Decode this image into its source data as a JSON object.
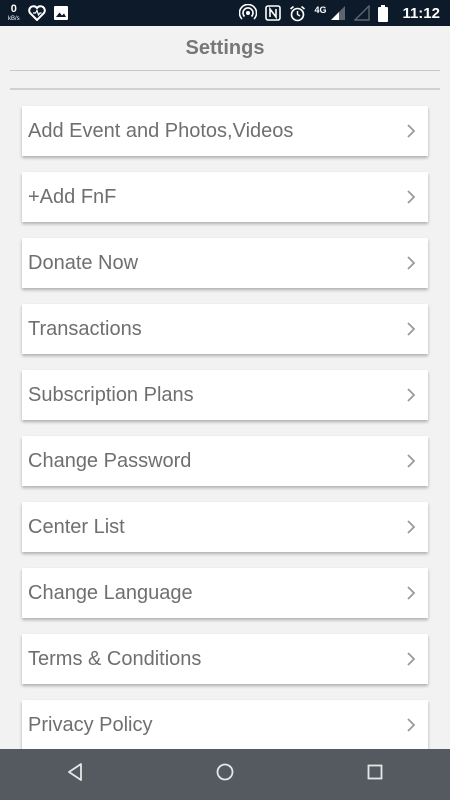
{
  "status_bar": {
    "speed_value": "0",
    "speed_unit": "kB/s",
    "network_type": "4G",
    "time": "11:12",
    "icons": [
      "heart-icon",
      "image-icon",
      "hotspot-icon",
      "nfc-icon",
      "alarm-icon",
      "signal-icon",
      "battery-icon"
    ]
  },
  "header": {
    "title": "Settings"
  },
  "settings": {
    "items": [
      {
        "label": "Add Event and Photos,Videos"
      },
      {
        "label": "+Add FnF"
      },
      {
        "label": "Donate Now"
      },
      {
        "label": "Transactions"
      },
      {
        "label": "Subscription Plans"
      },
      {
        "label": "Change Password"
      },
      {
        "label": "Center List"
      },
      {
        "label": "Change Language"
      },
      {
        "label": "Terms & Conditions"
      },
      {
        "label": "Privacy Policy"
      }
    ]
  },
  "nav_bar": {
    "buttons": [
      "back-icon",
      "home-icon",
      "recents-icon"
    ]
  },
  "colors": {
    "status_bar_bg": "#0c1a2a",
    "background": "#f2f2f2",
    "title_text": "#777777",
    "item_text": "#6f6f6f",
    "nav_bar_bg": "#555a60"
  }
}
